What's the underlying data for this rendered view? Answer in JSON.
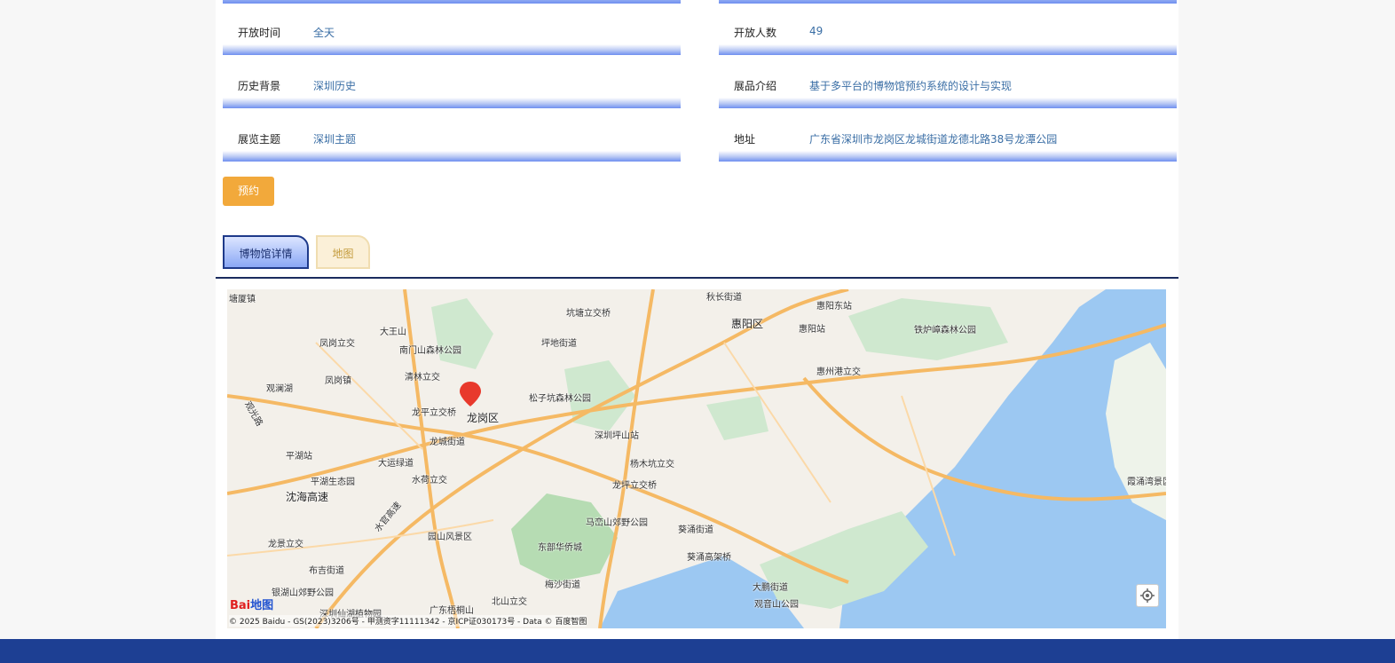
{
  "info_left": [
    {
      "label": "开放时间",
      "value": "全天"
    },
    {
      "label": "历史背景",
      "value": "深圳历史"
    },
    {
      "label": "展览主题",
      "value": "深圳主题"
    }
  ],
  "info_right": [
    {
      "label": "开放人数",
      "value": "49"
    },
    {
      "label": "展品介绍",
      "value": "基于多平台的博物馆预约系统的设计与实现"
    },
    {
      "label": "地址",
      "value": "广东省深圳市龙岗区龙城街道龙德北路38号龙潭公园"
    }
  ],
  "book_button": "预约",
  "tabs": [
    {
      "label": "博物馆详情",
      "active": true
    },
    {
      "label": "地图",
      "active": false
    }
  ],
  "map": {
    "labels": {
      "l1": "惠阳区",
      "l2": "惠阳东站",
      "l3": "惠阳站",
      "l4": "铁炉嶂森林公园",
      "l5": "惠州港立交",
      "l6": "坑塘立交桥",
      "l7": "坪地街道",
      "l8": "松子坑森林公园",
      "l9": "深圳坪山站",
      "l10": "杨木坑立交",
      "l11": "龙坪立交桥",
      "l12": "马峦山郊野公园",
      "l13": "东部华侨城",
      "l14": "葵涌街道",
      "l15": "葵涌高架桥",
      "l16": "大鹏街道",
      "l17": "观音山公园",
      "l18": "霞涌湾景区",
      "l19": "大王山",
      "l20": "南门山森林公园",
      "l21": "凤岗立交",
      "l22": "凤岗镇",
      "l23": "清林立交",
      "l24": "龙平立交桥",
      "l25": "龙岗区",
      "l26": "龙城街道",
      "l27": "观澜湖",
      "l28": "观光路",
      "l29": "平湖站",
      "l30": "平湖生态园",
      "l31": "大运绿道",
      "l32": "水荷立交",
      "l33": "沈海高速",
      "l34": "龙景立交",
      "l35": "布吉街道",
      "l36": "园山风景区",
      "l37": "梅沙街道",
      "l38": "北山立交",
      "l39": "银湖山郊野公园",
      "l40": "深圳仙湖植物园",
      "l41": "广东梧桐山",
      "l42": "水官高速",
      "l43": "秋长街道",
      "l44": "塘厦镇"
    },
    "logo_main": "Bai",
    "logo_sub": "地图",
    "copyright": "© 2025 Baidu - GS(2023)3206号 - 甲测资字11111342 - 京ICP证030173号 - Data © 百度智图"
  },
  "colors": {
    "accent": "#f2a93b",
    "link": "#3a6ea5",
    "footer": "#1d3f93",
    "marker": "#e8392c"
  }
}
